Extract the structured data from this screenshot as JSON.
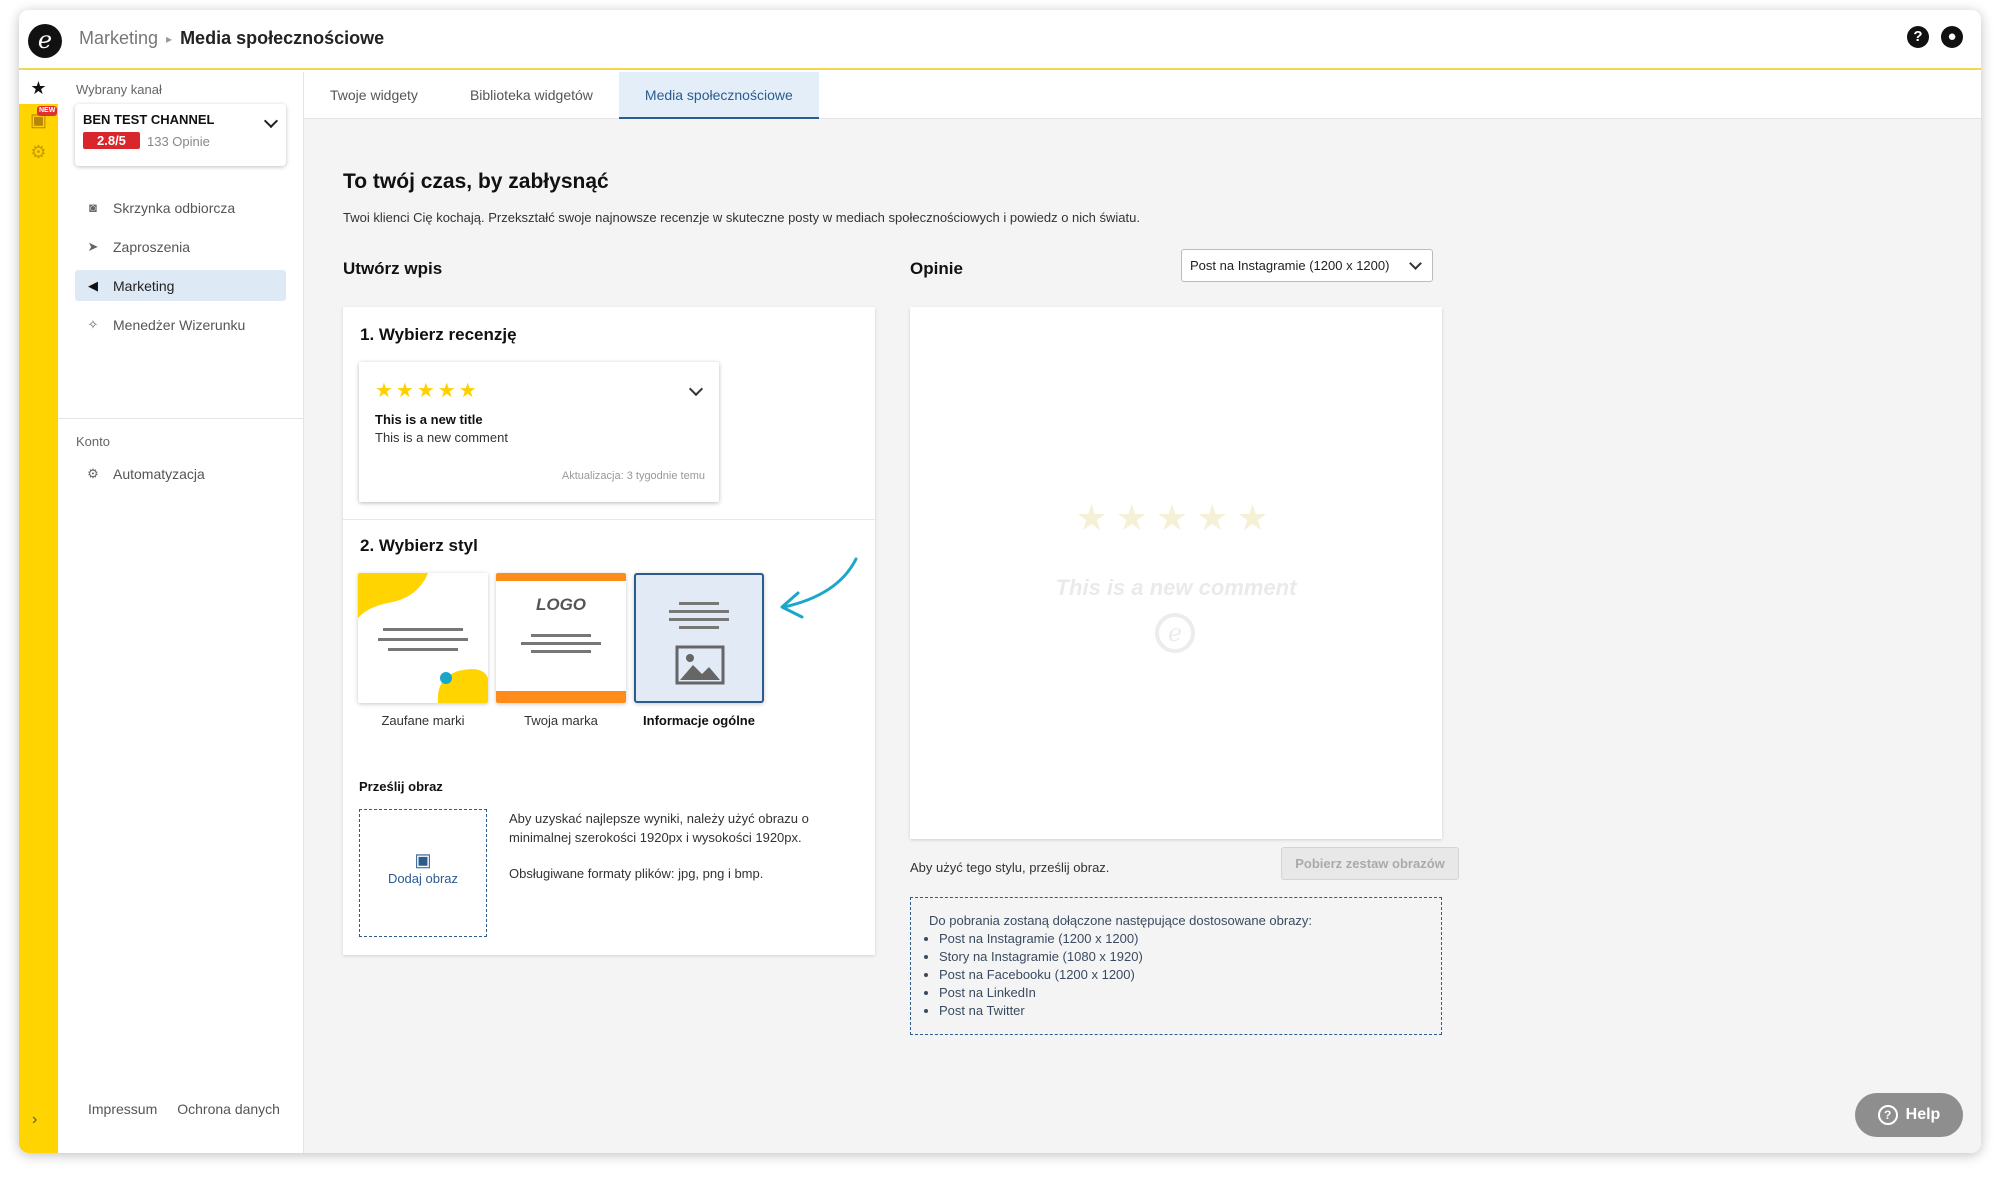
{
  "header": {
    "breadcrumb_parent": "Marketing",
    "breadcrumb_current": "Media społecznościowe",
    "help_icon": "question-circle-icon",
    "user_icon": "user-circle-icon"
  },
  "rail": {
    "items": [
      {
        "name": "star-icon",
        "glyph": "★"
      },
      {
        "name": "image-new-icon",
        "glyph": "▣"
      },
      {
        "name": "gear-icon",
        "glyph": "⚙"
      }
    ],
    "new_badge": "NEW",
    "expand_glyph": "›"
  },
  "sidebar": {
    "channel_label": "Wybrany kanał",
    "channel_name": "BEN TEST CHANNEL",
    "channel_score": "2.8/5",
    "channel_count": "133 Opinie",
    "nav": [
      {
        "label": "Skrzynka odbiorcza",
        "icon": "inbox-icon",
        "glyph": "◙"
      },
      {
        "label": "Zaproszenia",
        "icon": "paper-plane-icon",
        "glyph": "➤"
      },
      {
        "label": "Marketing",
        "icon": "megaphone-icon",
        "glyph": "◀"
      },
      {
        "label": "Menedżer Wizerunku",
        "icon": "sparkle-icon",
        "glyph": "✧"
      }
    ],
    "account_label": "Konto",
    "account_nav": [
      {
        "label": "Automatyzacja",
        "icon": "gear-automation-icon",
        "glyph": "⚙"
      }
    ],
    "footer_links": [
      "Impressum",
      "Ochrona danych"
    ]
  },
  "tabs": [
    "Twoje widgety",
    "Biblioteka widgetów",
    "Media społecznościowe"
  ],
  "main": {
    "title": "To twój czas, by zabłysnąć",
    "intro": "Twoi klienci Cię kochają. Przekształć swoje najnowsze recenzje w skuteczne posty w mediach społecznościowych i powiedz o nich światu.",
    "create_title": "Utwórz wpis",
    "step1_title": "1. Wybierz recenzję",
    "review": {
      "stars": "★★★★★",
      "title": "This is a new title",
      "comment": "This is a new comment",
      "updated": "Aktualizacja: 3 tygodnie temu"
    },
    "step2_title": "2. Wybierz styl",
    "styles": [
      "Zaufane marki",
      "Twoja marka",
      "Informacje ogólne"
    ],
    "logo_text": "LOGO",
    "upload_label": "Prześlij obraz",
    "upload_button": "Dodaj obraz",
    "upload_note_1": "Aby uzyskać najlepsze wyniki, należy użyć obrazu o minimalnej szerokości 1920px i wysokości 1920px.",
    "upload_note_2": "Obsługiwane formaty plików: jpg, png i bmp."
  },
  "preview": {
    "title": "Opinie",
    "format_select": "Post na Instagramie (1200 x 1200)",
    "stars": "★★★★★",
    "comment": "This is a new comment",
    "note": "Aby użyć tego stylu, prześlij obraz.",
    "download_button": "Pobierz zestaw obrazów",
    "info_intro": "Do pobrania zostaną dołączone następujące dostosowane obrazy:",
    "info_items": [
      "Post na Instagramie (1200 x 1200)",
      "Story na Instagramie (1080 x 1920)",
      "Post na Facebooku (1200 x 1200)",
      "Post na LinkedIn",
      "Post na Twitter"
    ]
  },
  "help": {
    "label": "Help"
  },
  "colors": {
    "accent_yellow": "#ffd400",
    "accent_blue": "#2a5c90",
    "score_red": "#d9262c",
    "arrow_cyan": "#1aa7c9"
  }
}
